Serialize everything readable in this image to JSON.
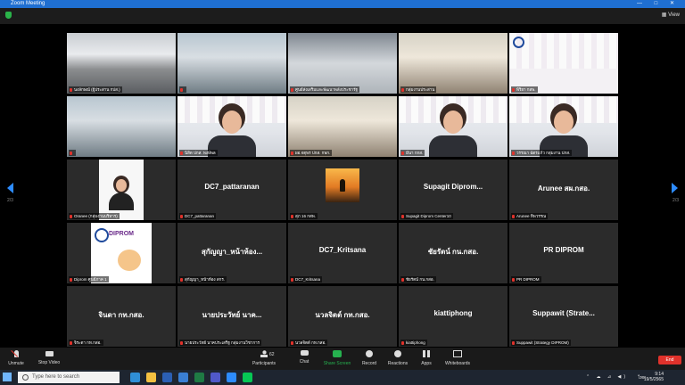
{
  "window": {
    "title": "Zoom Meeting",
    "controls": [
      "—",
      "□",
      "✕"
    ],
    "view_label": "View"
  },
  "pager": {
    "left": "2/3",
    "right": "2/3"
  },
  "tiles": [
    {
      "label": "นงลักษณ์ (ผู้ประสาน กปส.)",
      "kind": "room"
    },
    {
      "label": "",
      "kind": "office"
    },
    {
      "label": "ศูนย์ส่งเสริมและพัฒนาพลังประชารัฐ",
      "kind": "poster"
    },
    {
      "label": "กลุ่มงานประสาน",
      "kind": "meet"
    },
    {
      "label": "พิริยา กสพ.",
      "kind": "brand"
    },
    {
      "label": "",
      "kind": "office"
    },
    {
      "label": "นิสิต ปกส. พงษ์พล",
      "kind": "person"
    },
    {
      "label": "ผอ.จตุพร ปกส. กพก.",
      "kind": "meet"
    },
    {
      "label": "มีนา กกส.",
      "kind": "person"
    },
    {
      "label": "วรรณา ฉัตรแก้ว กลุ่มงาน ปกส.",
      "kind": "person"
    },
    {
      "label": "Oranee (กลุ่มงานบริหาร)",
      "kind": "thumb"
    },
    {
      "label": "DC7_pattaranan",
      "name": "DC7_pattaranan",
      "kind": "name"
    },
    {
      "label": "สุภ 16 กสพ.",
      "kind": "sunset"
    },
    {
      "label": "Supagit Diprom Center10",
      "name": "Supagit  Diprom...",
      "kind": "name"
    },
    {
      "label": "Arunee ทิพวรรณ",
      "name": "Arunee สผ.กสอ.",
      "kind": "name"
    },
    {
      "label": "Diprom ศูนย์ภาค 1",
      "kind": "diprom"
    },
    {
      "label": "สุกัญญา_หน้าห้อง สกร.",
      "name": "สุกัญญา_หน้าห้อง...",
      "kind": "name"
    },
    {
      "label": "DC7_Kritsana",
      "name": "DC7_Kritsana",
      "kind": "name"
    },
    {
      "label": "ชัยรัตน์ กน.กสอ.",
      "name": "ชัยรัตน์ กน.กสอ.",
      "kind": "name"
    },
    {
      "label": "PR DIPROM",
      "name": "PR DIPROM",
      "kind": "name"
    },
    {
      "label": "จิระดา กท.กสอ.",
      "name": "จินดา กท.กสอ.",
      "kind": "name"
    },
    {
      "label": "นายประวัทย์ นาคประเสริฐ กลุ่มงานวิชาการ",
      "name": "นายประวัทย์ นาค...",
      "kind": "name"
    },
    {
      "label": "นวลจิตต์ กท.กสอ.",
      "name": "นวลจิตต์ กท.กสอ.",
      "kind": "name"
    },
    {
      "label": "kiattiphong",
      "name": "kiattiphong",
      "kind": "name"
    },
    {
      "label": "Suppawit (Strategy DIPROM)",
      "name": "Suppawit  (Strate...",
      "kind": "name"
    }
  ],
  "toolbar": {
    "unmute": "Unmute",
    "stop_video": "Stop Video",
    "participants": "Participants",
    "participants_count": "62",
    "chat": "Chat",
    "share_screen": "Share Screen",
    "record": "Record",
    "reactions": "Reactions",
    "apps": "Apps",
    "whiteboards": "Whiteboards",
    "end": "End"
  },
  "taskbar": {
    "search_placeholder": "Type here to search",
    "time": "9:14",
    "date": "19/5/2565",
    "lang": "ไทย",
    "apps": [
      {
        "name": "edge-icon",
        "color": "#2f8fd8"
      },
      {
        "name": "file-explorer-icon",
        "color": "#f3c041"
      },
      {
        "name": "word-icon",
        "color": "#2b5fb4"
      },
      {
        "name": "mail-icon",
        "color": "#3a7fd5"
      },
      {
        "name": "excel-icon",
        "color": "#1f7a44"
      },
      {
        "name": "teams-icon",
        "color": "#5059c9"
      },
      {
        "name": "zoom-icon",
        "color": "#2d8cff"
      },
      {
        "name": "line-icon",
        "color": "#06c755"
      }
    ]
  },
  "colors": {
    "accent": "#2d8cff",
    "titlebar": "#1f6fd1",
    "end": "#e0322b",
    "share": "#26b14f"
  }
}
